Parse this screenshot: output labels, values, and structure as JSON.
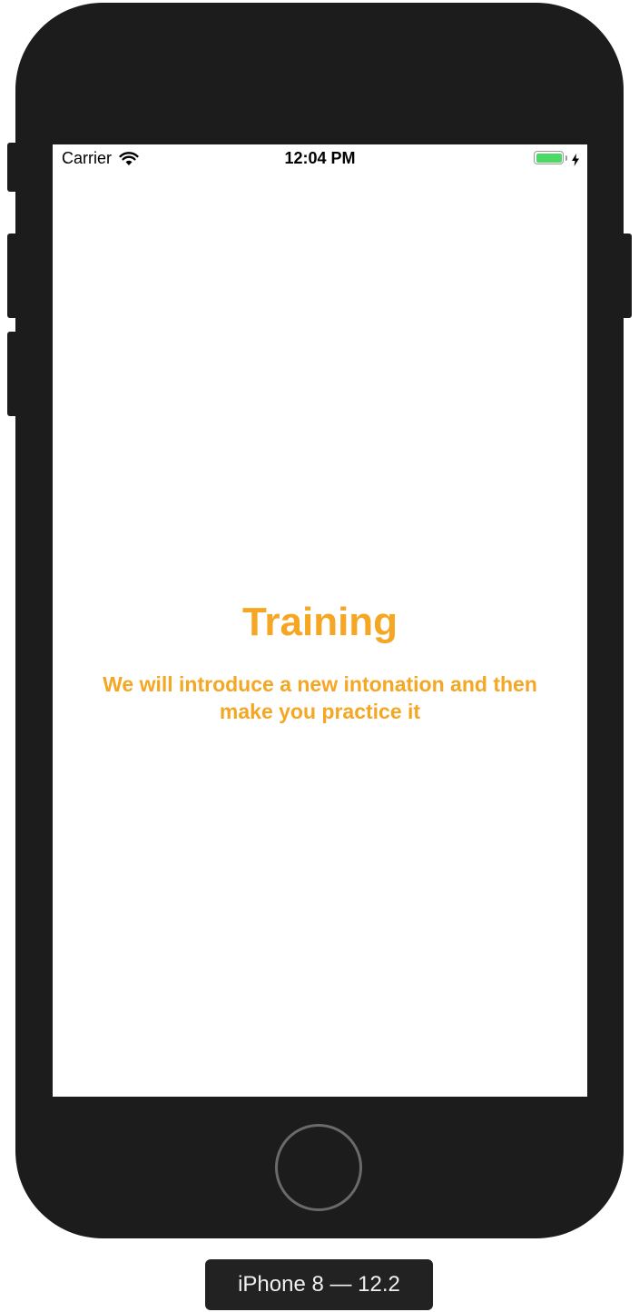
{
  "status_bar": {
    "carrier": "Carrier",
    "wifi_icon": "wifi-icon",
    "time": "12:04 PM",
    "battery_icon": "battery-icon",
    "battery_level": 1.0,
    "charging_icon": "lightning-bolt-icon",
    "battery_color": "#4cd964"
  },
  "main": {
    "title": "Training",
    "subtitle": "We will introduce a new intonation and then make you practice it",
    "accent_color": "#f5a623"
  },
  "device": {
    "label": "iPhone 8 — 12.2",
    "home_button_icon": "home-button"
  }
}
